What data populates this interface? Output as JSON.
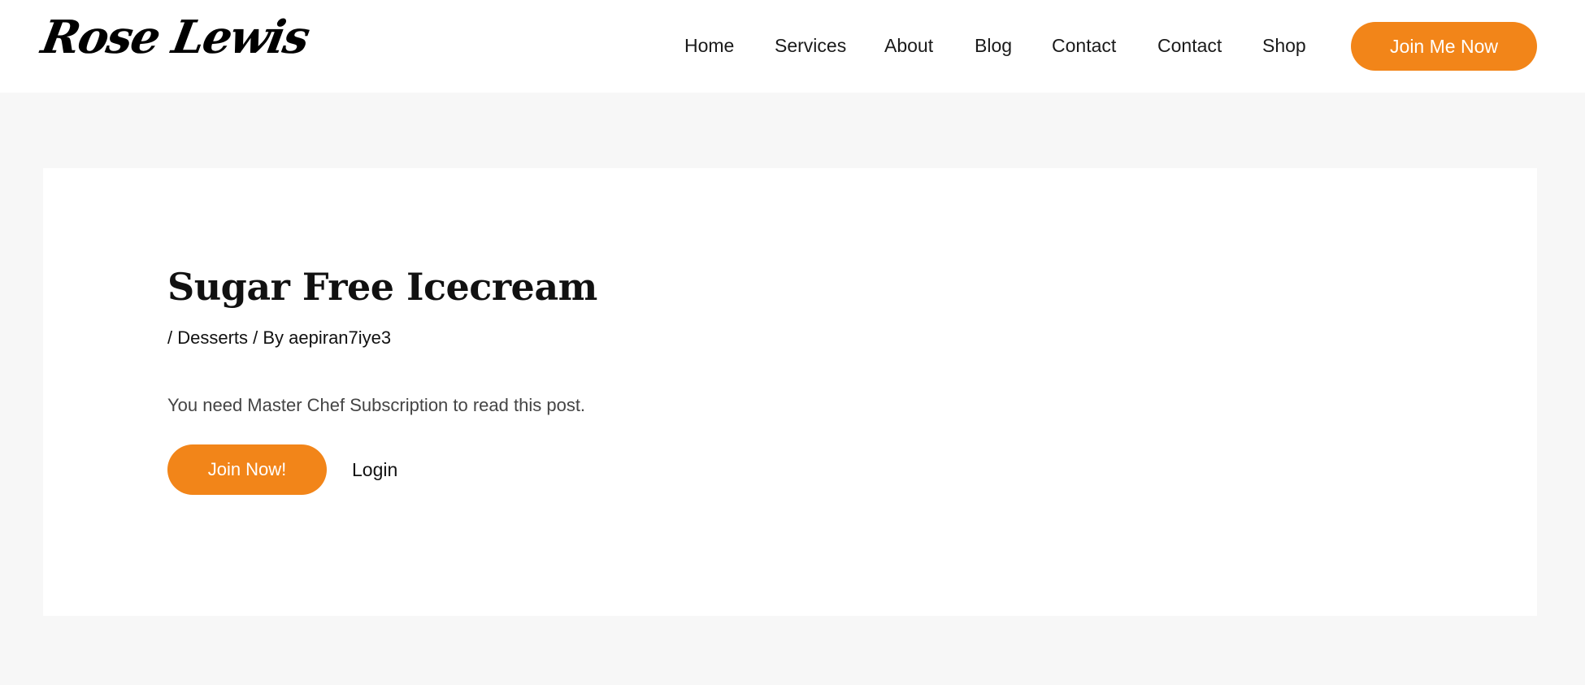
{
  "site": {
    "logo_text": "Rose Lewis"
  },
  "nav": {
    "items": [
      {
        "label": "Home"
      },
      {
        "label": "Services"
      },
      {
        "label": "About"
      },
      {
        "label": "Blog"
      },
      {
        "label": "Contact"
      },
      {
        "label": "Contact"
      },
      {
        "label": "Shop"
      }
    ],
    "cta_label": "Join Me Now"
  },
  "post": {
    "title": "Sugar Free Icecream",
    "meta_prefix": "/ ",
    "category": "Desserts",
    "meta_by": " / By ",
    "author": "aepiran7iye3",
    "notice": "You need Master Chef Subscription to read this post.",
    "join_label": "Join Now!",
    "login_label": "Login"
  },
  "colors": {
    "accent": "#f28519",
    "page_background": "#f7f7f7",
    "panel_background": "#ffffff"
  }
}
